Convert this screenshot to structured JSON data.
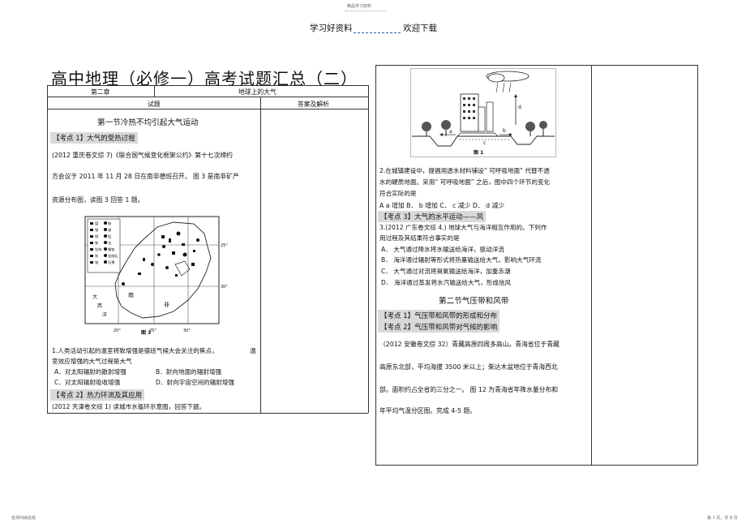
{
  "top_tiny": "精品学习资料",
  "banner": {
    "left": "学习好资料",
    "right": "欢迎下载"
  },
  "title": "高中地理（必修一）高考试题汇总（二）",
  "table_header": {
    "chapter": "第二章",
    "chapter_title": "地球上的大气",
    "col_questions": "试题",
    "col_answers": "答案及解析"
  },
  "left": {
    "section1": "第一节冷热不均引起大气运动",
    "kd1": "【考点 1】大气的受热过程",
    "q_intro_1": "(2012 重庆卷文综   7)《联合国气候变化框架公约》第十七次缔约",
    "q_intro_2": "方会议于   2011  年 11 月 28 日在南非德班召开。 图 3 是南非矿产",
    "q_intro_3": "资源分布图，读图    3  回答  1  题。",
    "map": {
      "legend": [
        "煤",
        "铂",
        "铬",
        "锑",
        "铜",
        "锰",
        "铁",
        "金",
        "铅锌",
        "镍铂",
        "钒",
        "金刚石",
        "铀",
        "石棉"
      ],
      "labels": [
        "南",
        "非",
        "大",
        "西",
        "洋"
      ],
      "lat1": "25°",
      "lat2": "30°",
      "lon1": "20°",
      "lon2": "25°",
      "lon3": "30°",
      "fig": "图  3"
    },
    "q1_line1": "1.人类活动引起的温室将致增强是德班气候大会关注的焦点，",
    "q1_line1_end": "温",
    "q1_line2": "室效应增强的大气过程是大气",
    "q1_a": "A．对太阳辐射的散射增强",
    "q1_b": "B．射向地面的辐射增强",
    "q1_c": "C．对太阳辐射吸收增强",
    "q1_d": "D．射向宇宙空间的辐射增强",
    "kd2": "【考点  2】热力环流及其应用",
    "q2_intro": "(2012 天津卷文综   1) 读城市水循环示意图，回答下题。"
  },
  "right": {
    "fig1_labels": [
      "a",
      "b",
      "c",
      "d"
    ],
    "fig1_caption": "图 1",
    "q2_line1": "2.在城镇建设中，提倡用透水材料铺设“ 可呼吸地面” 代替不透",
    "q2_line2": "水的硬质地面。采用“ 可呼吸地面” 之后，图中四个环节的变化",
    "q2_line3": "符合实际的是",
    "q2_opts": "A a 增加 B． b 增加 C． c 减少 D． d 减少",
    "kd3": "【考点  3】大气的水平运动——风",
    "q3_line1": "3.(2012  广东卷文综   4.) 地球大气与海洋相互作用的。下列作",
    "q3_line2": "用过程及其结果符合事实的是",
    "q3_a": "A．  大气通过降水将水输送给海洋，驱动洋流",
    "q3_b": "B．  海洋通过辐射等形式将热量输送给大气，影响大气环流",
    "q3_c": "C．  大气通过对流将臭氧输送给海洋，加重赤潮",
    "q3_d": "D．  海洋通过蒸发将水汽输送给大气，形成信风",
    "section2": "第二节气压带和风带",
    "kd4": "【考点  1】气压带和风带的形成和分布",
    "kd5": "【考点  2】气压带和风带对气候的影响",
    "q4_line1": "（2012 安徽卷文综   32）青藏高原四周多高山。青海省位于青藏",
    "q4_line2": "高原东北部，平均海拔     3500  米以上；柴达木盆地位于青海西北",
    "q4_line3": "部。面积约占全省的三分之一。 图        12  为青海省年降水量分布和",
    "q4_line4": "年平均气温分区图。完成        4-5  题。"
  },
  "footer": {
    "left": "名师归纳总结",
    "right": "第 1 页，共 8 页"
  }
}
